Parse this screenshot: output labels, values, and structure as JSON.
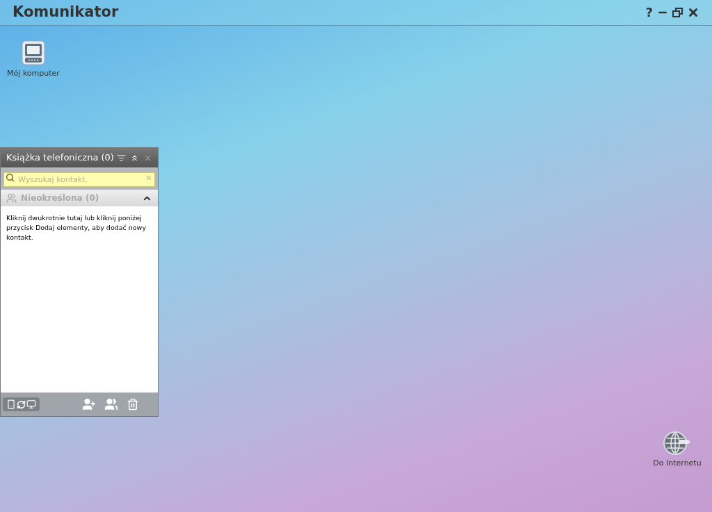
{
  "window": {
    "title": "Komunikator",
    "help": "?"
  },
  "desktop_icons": [
    {
      "label": "Mój komputer",
      "kind": "computer"
    },
    {
      "label": "Do Internetu",
      "kind": "internet"
    }
  ],
  "phonebook": {
    "title": "Książka telefoniczna (0)",
    "search": {
      "placeholder": "Wyszukaj kontakt."
    },
    "group": {
      "label": "Nieokreślona (0)",
      "expanded": true
    },
    "message": "Kliknij dwukrotnie tutaj lub kliknij poniżej przycisk Dodaj elementy, aby dodać nowy kontakt."
  }
}
